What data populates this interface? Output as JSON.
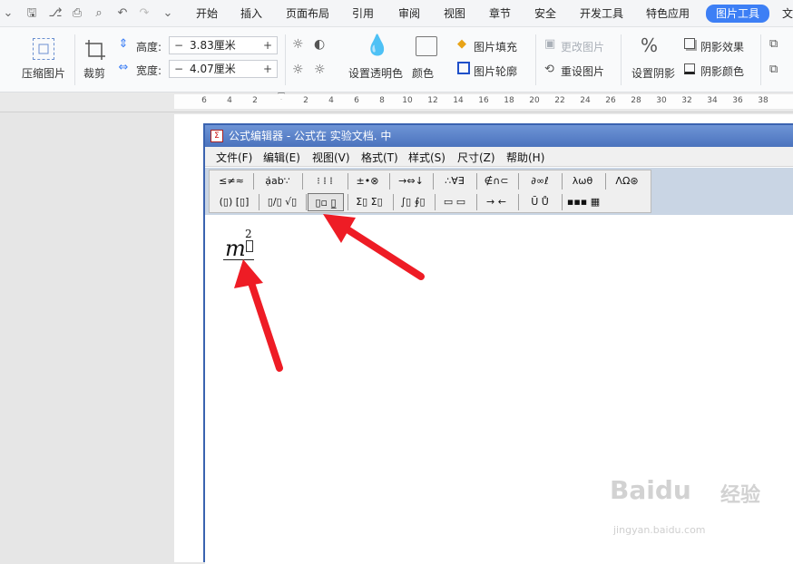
{
  "quick_access": {
    "icons": [
      "chevron-down-icon",
      "save-icon",
      "format-painter-icon",
      "print-icon",
      "print-preview-icon",
      "undo-icon",
      "redo-icon",
      "customize-icon"
    ]
  },
  "tabs": [
    "开始",
    "插入",
    "页面布局",
    "引用",
    "审阅",
    "视图",
    "章节",
    "安全",
    "开发工具",
    "特色应用",
    "图片工具",
    "文"
  ],
  "ribbon": {
    "compress": "压缩图片",
    "crop": "裁剪",
    "height_label": "高度:",
    "height_value": "3.83厘米",
    "width_label": "宽度:",
    "width_value": "4.07厘米",
    "minus": "−",
    "plus": "+",
    "transparent": "设置透明色",
    "color": "颜色",
    "fill": "图片填充",
    "outline": "图片轮廓",
    "change": "更改图片",
    "reset": "重设图片",
    "shadow_set": "设置阴影",
    "shadow_effect": "阴影效果",
    "shadow_color": "阴影颜色"
  },
  "ruler": {
    "ticks": [
      "6",
      "4",
      "2",
      "2",
      "4",
      "6",
      "8",
      "10",
      "12",
      "14",
      "16",
      "18",
      "20",
      "22",
      "24",
      "26",
      "28",
      "30",
      "32",
      "34",
      "36",
      "38"
    ]
  },
  "equation_editor": {
    "title": "公式编辑器 - 公式在 实验文档. 中",
    "menu": [
      "文件(F)",
      "编辑(E)",
      "视图(V)",
      "格式(T)",
      "样式(S)",
      "尺寸(Z)",
      "帮助(H)"
    ],
    "palette_row1": [
      "≤≠≈",
      "ạ̇ab∵",
      "⁝ ⁞ ⁞",
      "±•⊗",
      "→⇔↓",
      "∴∀∃",
      "∉∩⊂",
      "∂∞ℓ",
      "λωθ",
      "ΛΩ⊛"
    ],
    "palette_row2": [
      "(▯) [▯]",
      "▯/▯ √▯",
      "▯▫ ▯̲",
      "Σ▯ Σ▯",
      "∫▯ ∮▯",
      "▭ ▭",
      "→ ←",
      "Ū Ů",
      "▪▪▪ ▦"
    ],
    "formula_base": "m",
    "formula_sup": "2"
  },
  "watermark": {
    "brand": "Baidu",
    "brand_cn": "经验",
    "url": "jingyan.baidu.com"
  },
  "colors": {
    "accent": "#3d7ff5",
    "title_bar": "#4b73bd",
    "arrow": "#ee1c25"
  }
}
